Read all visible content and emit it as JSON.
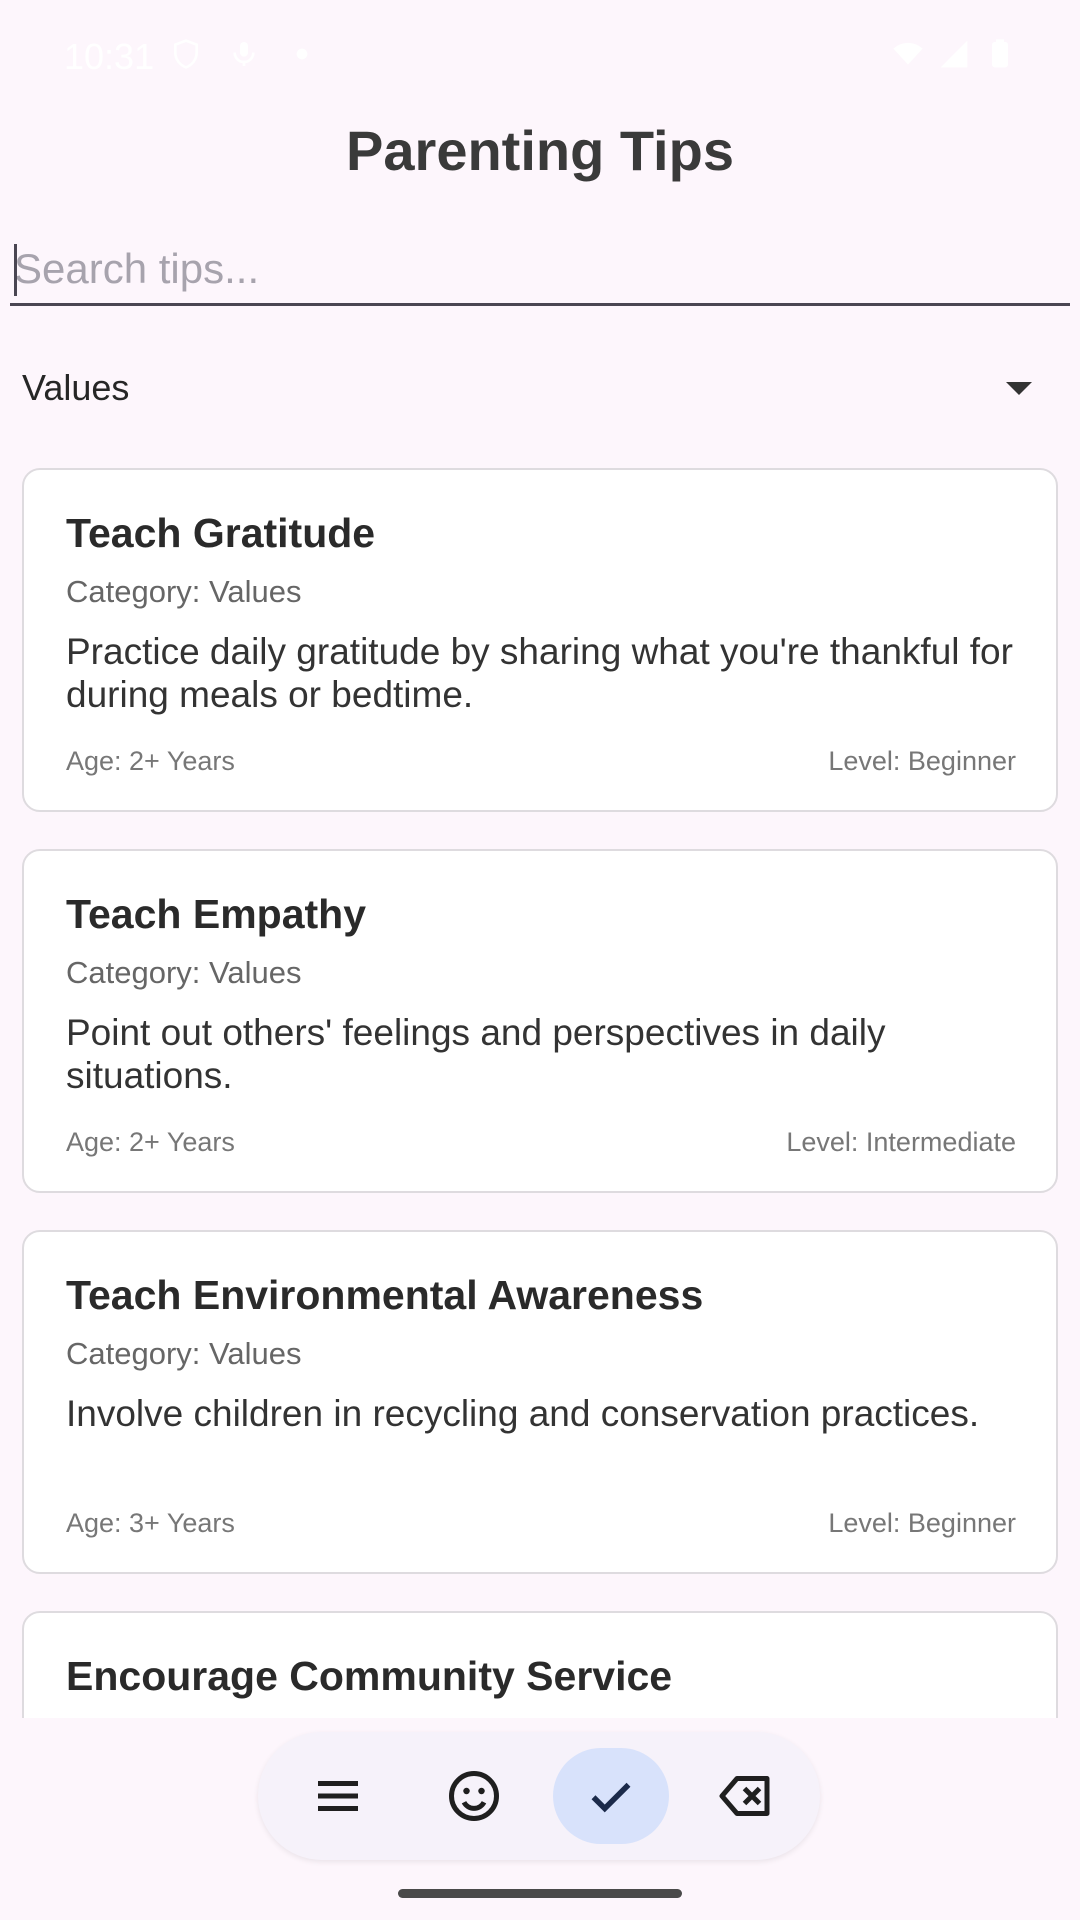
{
  "status_bar": {
    "time": "10:31",
    "left_icons": [
      "shield-icon",
      "mic-off-icon",
      "dot-icon"
    ],
    "right_icons": [
      "wifi-icon",
      "signal-icon",
      "battery-icon"
    ]
  },
  "header": {
    "title": "Parenting Tips"
  },
  "search": {
    "placeholder": "Search tips...",
    "value": ""
  },
  "filter": {
    "selected": "Values"
  },
  "tips": [
    {
      "title": "Teach Gratitude",
      "category": "Category: Values",
      "description": "Practice daily gratitude by sharing what you're thankful for during meals or bedtime.",
      "age": "Age: 2+ Years",
      "level": "Level: Beginner"
    },
    {
      "title": "Teach Empathy",
      "category": "Category: Values",
      "description": "Point out others' feelings and perspectives in daily situations.",
      "age": "Age: 2+ Years",
      "level": "Level: Intermediate"
    },
    {
      "title": "Teach Environmental Awareness",
      "category": "Category: Values",
      "description": "Involve children in recycling and conservation practices.",
      "age": "Age: 3+ Years",
      "level": "Level: Beginner"
    },
    {
      "title": "Encourage Community Service",
      "category": "",
      "description": "",
      "age": "",
      "level": ""
    }
  ],
  "keyboard_toolbar": {
    "buttons": [
      {
        "icon": "menu-icon",
        "active": false
      },
      {
        "icon": "emoji-icon",
        "active": false
      },
      {
        "icon": "check-icon",
        "active": true
      },
      {
        "icon": "backspace-icon",
        "active": false
      }
    ]
  },
  "colors": {
    "background": "#fdf6fc",
    "card_border": "#dedbdf",
    "active_button": "#d8e2fb"
  }
}
